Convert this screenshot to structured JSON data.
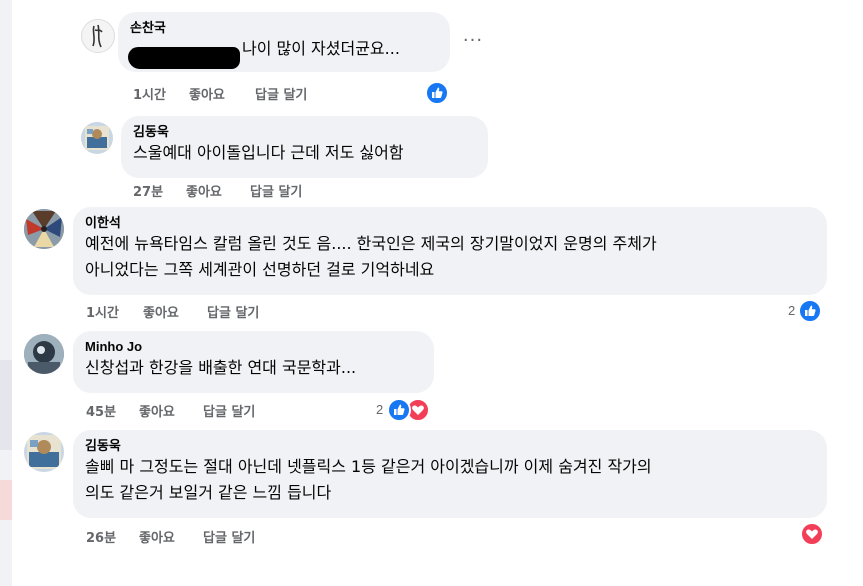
{
  "comments": [
    {
      "author": "손찬국",
      "text": "나이 많이 자셨더균요...",
      "time": "1시간",
      "like": "좋아요",
      "reply": "답글 달기",
      "reaction_count": "",
      "reactions": [
        "like-icon"
      ]
    },
    {
      "author": "김동욱",
      "text": "스울예대 아이돌입니다 근데 저도 싫어함",
      "time": "27분",
      "like": "좋아요",
      "reply": "답글 달기",
      "reaction_count": "",
      "reactions": []
    },
    {
      "author": "이한석",
      "text_lines": [
        "예전에 뉴욕타임스 칼럼 올린 것도 음.... 한국인은 제국의 장기말이었지 운명의 주체가",
        "아니었다는 그쪽 세계관이 선명하던 걸로 기억하네요"
      ],
      "time": "1시간",
      "like": "좋아요",
      "reply": "답글 달기",
      "reaction_count": "2",
      "reactions": [
        "like-icon"
      ]
    },
    {
      "author": "Minho Jo",
      "text": "신창섭과 한강을 배출한 연대 국문학과...",
      "time": "45분",
      "like": "좋아요",
      "reply": "답글 달기",
      "reaction_count": "2",
      "reactions": [
        "like-icon",
        "love-icon"
      ]
    },
    {
      "author": "김동욱",
      "text_lines": [
        "솔삐 마 그정도는 절대 아닌데 넷플릭스 1등 같은거 아이겠습니까 이제 숨겨진 작가의",
        "의도 같은거 보일거 같은 느낌 듭니다"
      ],
      "time": "26분",
      "like": "좋아요",
      "reply": "답글 달기",
      "reaction_count": "",
      "reactions": [
        "love-icon"
      ]
    }
  ],
  "more_label": "···",
  "colors": {
    "bubble": "#f0f2f5",
    "meta_text": "#65676b",
    "like": "#1877f2",
    "love": "#f33e58"
  }
}
